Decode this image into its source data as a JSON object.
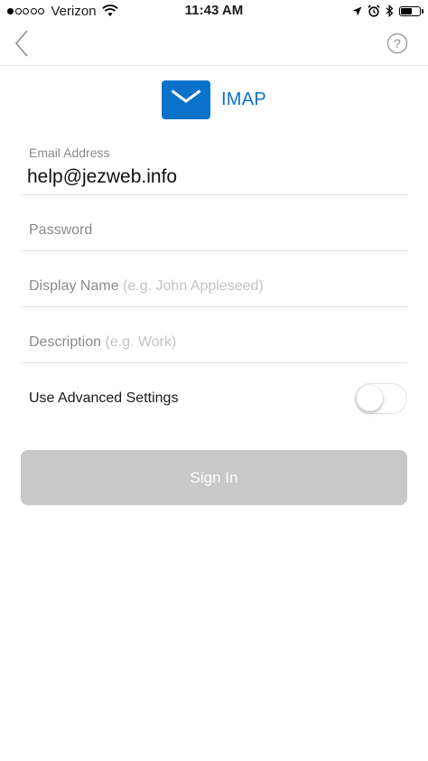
{
  "status_bar": {
    "carrier": "Verizon",
    "time": "11:43 AM",
    "signal_bars_filled": 1,
    "signal_bars_total": 5,
    "battery_level": 0.6
  },
  "nav": {
    "back_icon": "chevron-left-icon",
    "help_icon": "question-mark-icon",
    "help_glyph": "?"
  },
  "provider": {
    "name": "IMAP",
    "icon": "envelope-icon",
    "accent_color": "#0a72c8"
  },
  "form": {
    "email": {
      "label": "Email Address",
      "value": "help@jezweb.info"
    },
    "password": {
      "placeholder": "Password"
    },
    "display_name": {
      "label": "Display Name",
      "hint": "(e.g. John Appleseed)"
    },
    "description": {
      "label": "Description",
      "hint": "(e.g. Work)"
    },
    "advanced": {
      "label": "Use Advanced Settings",
      "enabled": false
    },
    "sign_in_label": "Sign In"
  }
}
